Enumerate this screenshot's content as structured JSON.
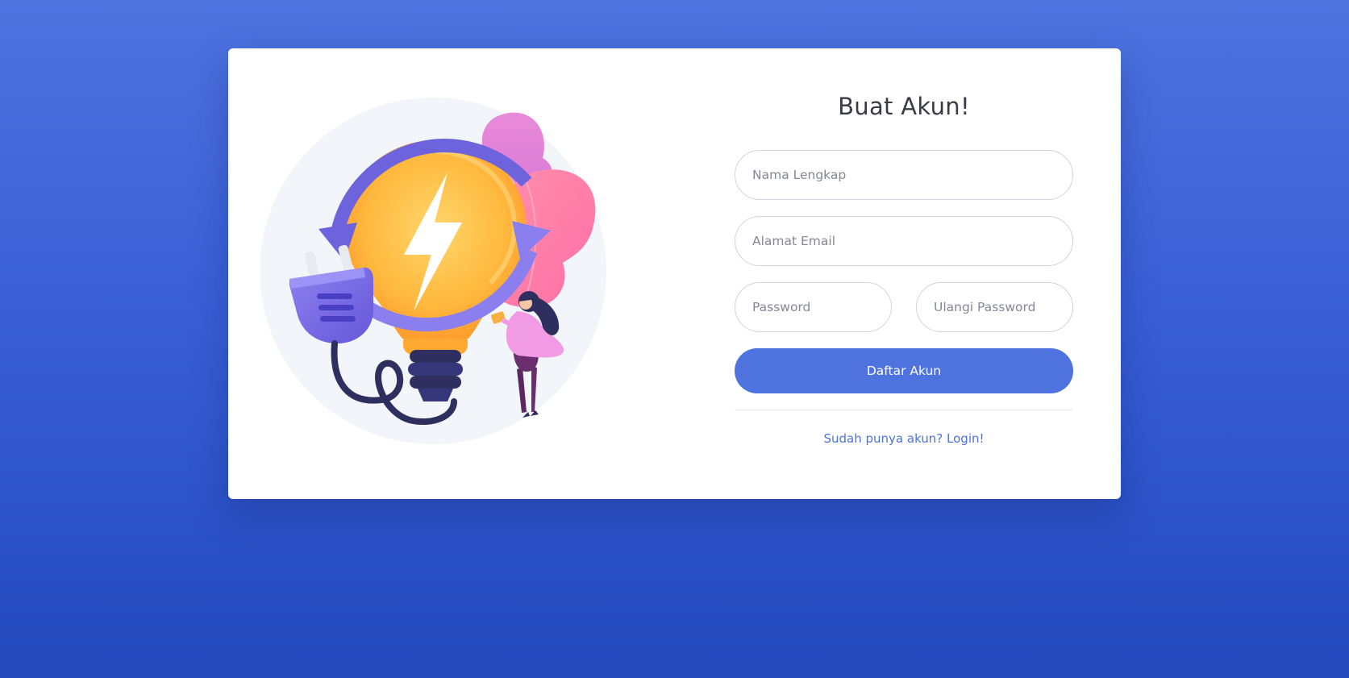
{
  "page": {
    "title": "Buat Akun!"
  },
  "form": {
    "full_name_placeholder": "Nama Lengkap",
    "email_placeholder": "Alamat Email",
    "password_placeholder": "Password",
    "repeat_password_placeholder": "Ulangi Password",
    "submit_label": "Daftar Akun"
  },
  "links": {
    "login": "Sudah punya akun? Login!"
  },
  "illustration": {
    "icons": [
      "lightbulb-icon",
      "lightning-bolt-icon",
      "refresh-arrows-icon",
      "power-plug-icon",
      "person-figure"
    ]
  },
  "colors": {
    "primary": "#4e73df",
    "background_top": "#4e73df",
    "background_bottom": "#2349bd",
    "card": "#ffffff",
    "input_border": "#d1d3e2",
    "text_dark": "#3a3b45"
  }
}
